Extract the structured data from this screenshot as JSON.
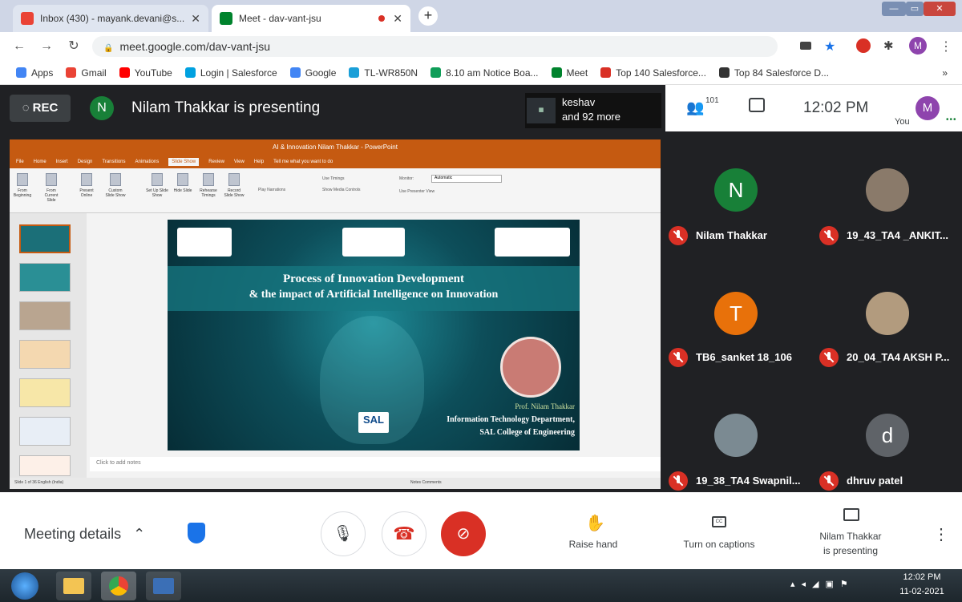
{
  "browser": {
    "tabs": [
      {
        "title": "Inbox (430) - mayank.devani@s...",
        "icon": "gmail-icon",
        "active": false
      },
      {
        "title": "Meet - dav-vant-jsu",
        "icon": "meet-icon",
        "active": true
      }
    ],
    "url": "meet.google.com/dav-vant-jsu",
    "profile_initial": "M",
    "bookmarks": [
      {
        "label": "Apps",
        "color": "#4285f4"
      },
      {
        "label": "Gmail",
        "color": "#ea4335"
      },
      {
        "label": "YouTube",
        "color": "#ff0000"
      },
      {
        "label": "Login | Salesforce",
        "color": "#00a1e0"
      },
      {
        "label": "Google",
        "color": "#4285f4"
      },
      {
        "label": "TL-WR850N",
        "color": "#1a9fd8"
      },
      {
        "label": "8.10 am Notice Boa...",
        "color": "#0f9d58"
      },
      {
        "label": "Meet",
        "color": "#00832d"
      },
      {
        "label": "Top 140 Salesforce...",
        "color": "#d93025"
      },
      {
        "label": "Top 84 Salesforce D...",
        "color": "#333333"
      }
    ],
    "bookmarks_more": "»"
  },
  "meet": {
    "rec_label": "REC",
    "presenter_initial": "N",
    "presenting_text": "Nilam Thakkar is presenting",
    "tile_name": "keshav",
    "tile_more": "and 92 more",
    "participant_count": "101",
    "time": "12:02 PM",
    "you_label": "You",
    "you_initial": "M",
    "participants": [
      {
        "name": "Nilam Thakkar",
        "initial": "N",
        "color": "#188038"
      },
      {
        "name": "19_43_TA4 _ANKIT...",
        "initial": "",
        "color": "#8a7a6a"
      },
      {
        "name": "TB6_sanket 18_106",
        "initial": "T",
        "color": "#e8710a"
      },
      {
        "name": "20_04_TA4 AKSH P...",
        "initial": "",
        "color": "#b29b7e"
      },
      {
        "name": "19_38_TA4 Swapnil...",
        "initial": "",
        "color": "#7b8a92"
      },
      {
        "name": "dhruv patel",
        "initial": "d",
        "color": "#5f6368"
      }
    ],
    "bottom": {
      "meeting_details": "Meeting details",
      "raise_hand": "Raise hand",
      "captions": "Turn on captions",
      "presenting_line1": "Nilam Thakkar",
      "presenting_line2": "is presenting"
    }
  },
  "ppt": {
    "title": "AI & Innovation Nilam Thakkar - PowerPoint",
    "menu": [
      "File",
      "Home",
      "Insert",
      "Design",
      "Transitions",
      "Animations",
      "Slide Show",
      "Review",
      "View",
      "Help",
      "Tell me what you want to do"
    ],
    "ribbon": [
      "From Beginning",
      "From Current Slide",
      "Present Online",
      "Custom Slide Show",
      "Set Up Slide Show",
      "Hide Slide",
      "Rehearse Timings",
      "Record Slide Show"
    ],
    "ribbon_checks": [
      "Play Narrations",
      "Use Timings",
      "Show Media Controls",
      "Use Presenter View"
    ],
    "monitor_label": "Monitor:",
    "monitor_value": "Automatic",
    "slide_title_1": "Process of Innovation Development",
    "slide_title_2": "& the impact of Artificial Intelligence on Innovation",
    "slide_name": "Prof. Nilam Thakkar",
    "slide_dept": "Information Technology Department,",
    "slide_college": "SAL College of Engineering",
    "slide_logo_sal": "SAL",
    "notes": "Click to add notes",
    "status_left": "Slide 1 of 36    English (India)",
    "status_right": "Notes    Comments"
  },
  "taskbar": {
    "time": "12:02 PM",
    "date": "11-02-2021"
  }
}
